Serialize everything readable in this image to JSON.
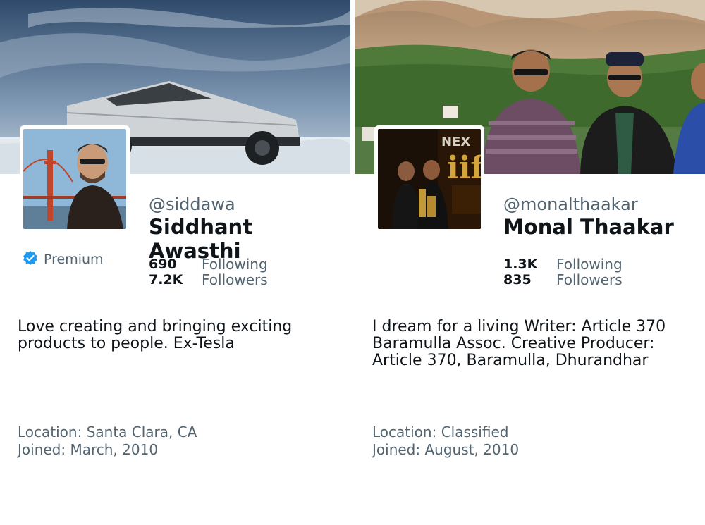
{
  "profiles": [
    {
      "handle": "@siddawa",
      "name": "Siddhant Awasthi",
      "premium_label": "Premium",
      "following_count": "690",
      "following_label": "Following",
      "followers_count": "7.2K",
      "followers_label": "Followers",
      "bio": "Love creating and bringing exciting products to people. Ex-Tesla",
      "location_prefix": "Location: ",
      "location": "Santa Clara, CA",
      "joined_prefix": "Joined: ",
      "joined": "March, 2010"
    },
    {
      "handle": "@monalthaakar",
      "name": "Monal Thaakar",
      "following_count": "1.3K",
      "following_label": "Following",
      "followers_count": "835",
      "followers_label": "Followers",
      "bio": "I dream for a living Writer: Article 370 Baramulla Assoc. Creative Producer: Article 370, Baramulla, Dhurandhar",
      "location_prefix": "Location: ",
      "location": "Classified",
      "joined_prefix": "Joined: ",
      "joined": "August, 2010"
    }
  ],
  "colors": {
    "primary_text": "#0f1419",
    "secondary_text": "#536471",
    "verified_blue": "#1d9bf0"
  },
  "icons": {
    "premium_badge": "verified-badge-icon"
  }
}
